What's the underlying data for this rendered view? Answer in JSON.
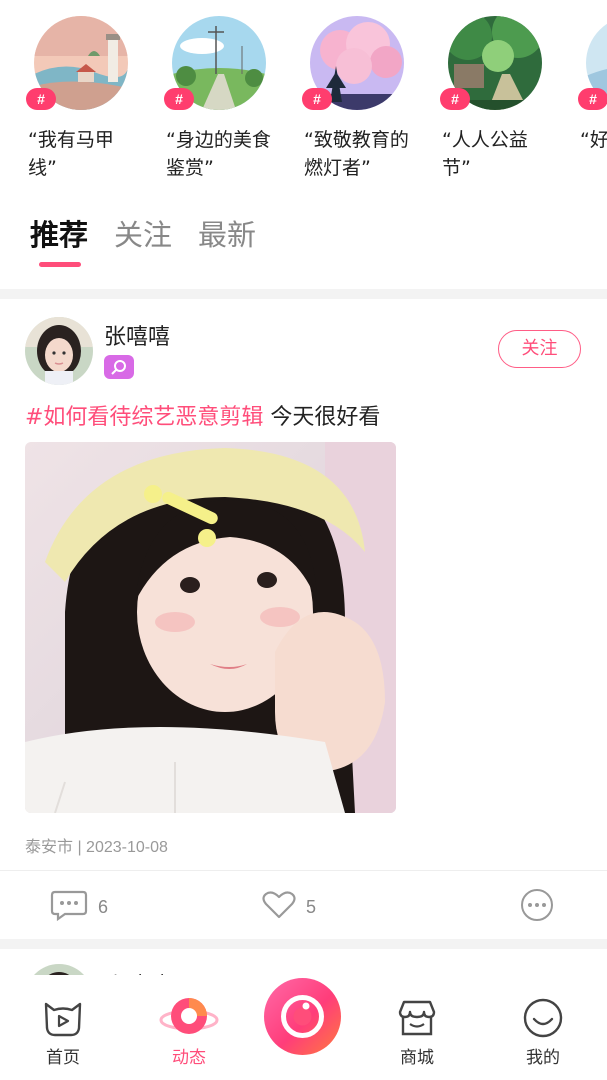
{
  "topics": [
    {
      "hash": "#",
      "label": "“我有马甲线”"
    },
    {
      "hash": "#",
      "label": "“身边的美食鉴赏”"
    },
    {
      "hash": "#",
      "label": "“致敬教育的燃灯者”"
    },
    {
      "hash": "#",
      "label": "“人人公益节”"
    },
    {
      "hash": "#",
      "label": "“好图鉴"
    }
  ],
  "tabs": [
    {
      "label": "推荐",
      "active": true
    },
    {
      "label": "关注",
      "active": false
    },
    {
      "label": "最新",
      "active": false
    }
  ],
  "post": {
    "username": "张嘻嘻",
    "follow_label": "关注",
    "hashtag": "#如何看待综艺恶意剪辑",
    "text": " 今天很好看",
    "location_date": "泰安市 | 2023-10-08",
    "comments": "6",
    "likes": "5"
  },
  "post2": {
    "username": "张嘻嘻"
  },
  "nav": [
    {
      "label": "首页",
      "icon": "cat-play-icon",
      "active": false
    },
    {
      "label": "动态",
      "icon": "planet-icon",
      "active": true
    },
    {
      "label": "",
      "icon": "camera-icon",
      "active": false
    },
    {
      "label": "商城",
      "icon": "store-icon",
      "active": false
    },
    {
      "label": "我的",
      "icon": "smile-icon",
      "active": false
    }
  ],
  "colors": {
    "accent": "#ff4d7a",
    "hash_badge": "#ff3d6e",
    "gender_badge": "#d86ae6"
  }
}
